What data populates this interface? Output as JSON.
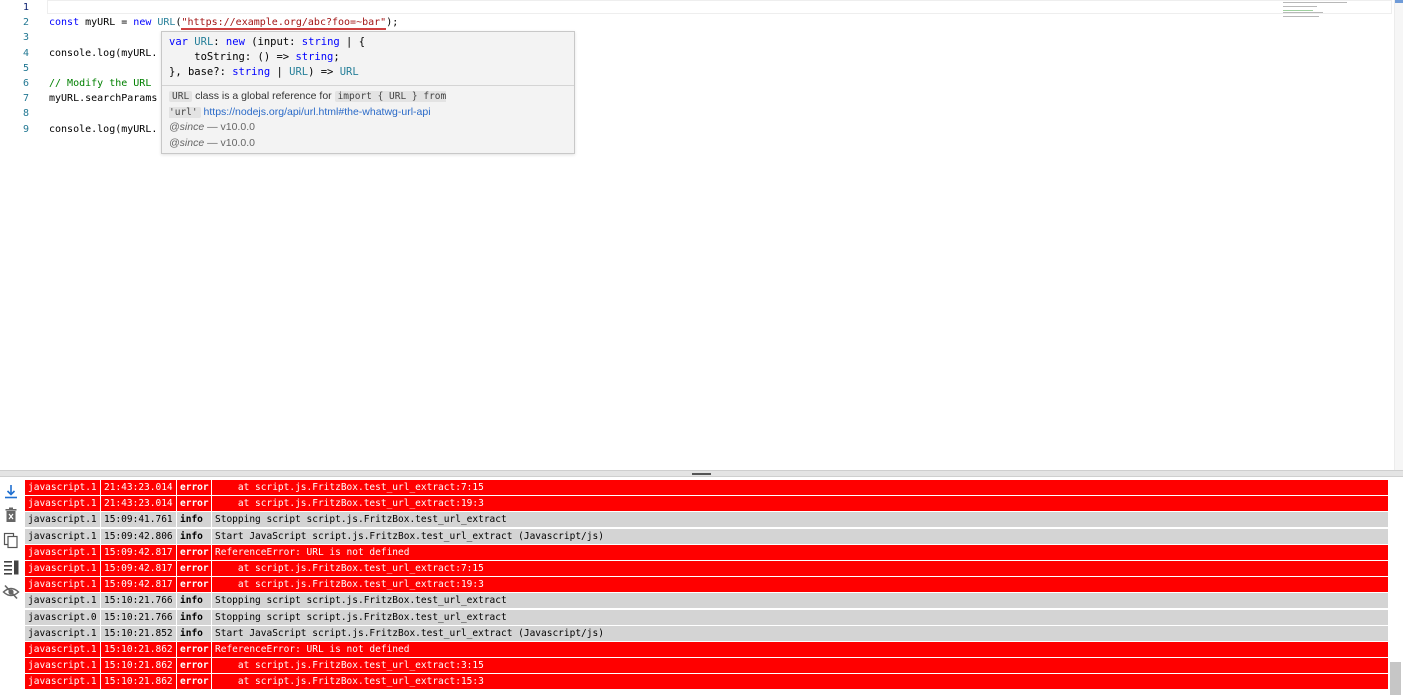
{
  "editor": {
    "line_numbers": [
      "1",
      "2",
      "3",
      "4",
      "5",
      "6",
      "7",
      "8",
      "9"
    ],
    "line2": {
      "kw_const": "const",
      "var_decl": " myURL = ",
      "kw_new": "new",
      "sp": " ",
      "type_url": "URL",
      "open": "(",
      "string": "\"https://example.org/abc?foo=~bar\"",
      "close": ");"
    },
    "line4": "console.log(myURL.",
    "line6_comment": "// Modify the URL ",
    "line7": "myURL.searchParams",
    "line9": "console.log(myURL."
  },
  "hover": {
    "sig_l1_kw": "var",
    "sig_l1_a": " ",
    "sig_l1_type": "URL",
    "sig_l1_b": ": ",
    "sig_l1_new": "new",
    "sig_l1_c": " (input: ",
    "sig_l1_string": "string",
    "sig_l1_d": " | {",
    "sig_l2_a": "    toString: () => ",
    "sig_l2_string": "string",
    "sig_l2_b": ";",
    "sig_l3_a": "}, base?: ",
    "sig_l3_string": "string",
    "sig_l3_b": " | ",
    "sig_l3_type": "URL",
    "sig_l3_c": ") => ",
    "sig_l3_ret": "URL",
    "doc_code1": "URL",
    "doc_text1": " class is a global reference for ",
    "doc_code2": "import { URL } from 'url'",
    "doc_link": "https://nodejs.org/api/url.html#the-whatwg-url-api",
    "since1_tag": "@since",
    "since1_val": " — v10.0.0",
    "since2_tag": "@since",
    "since2_val": " — v10.0.0"
  },
  "toolbar": {
    "icons": [
      "scroll-to-bottom-icon",
      "clear-log-icon",
      "copy-icon",
      "wrap-lines-icon",
      "hide-icon"
    ]
  },
  "log": {
    "rows": [
      {
        "source": "javascript.1",
        "time": "21:43:23.014",
        "level": "error",
        "message": "    at script.js.FritzBox.test_url_extract:7:15"
      },
      {
        "source": "javascript.1",
        "time": "21:43:23.014",
        "level": "error",
        "message": "    at script.js.FritzBox.test_url_extract:19:3"
      },
      {
        "source": "javascript.1",
        "time": "15:09:41.761",
        "level": "info",
        "message": "Stopping script script.js.FritzBox.test_url_extract"
      },
      {
        "source": "javascript.1",
        "time": "15:09:42.806",
        "level": "info",
        "message": "Start JavaScript script.js.FritzBox.test_url_extract (Javascript/js)"
      },
      {
        "source": "javascript.1",
        "time": "15:09:42.817",
        "level": "error",
        "message": "ReferenceError: URL is not defined"
      },
      {
        "source": "javascript.1",
        "time": "15:09:42.817",
        "level": "error",
        "message": "    at script.js.FritzBox.test_url_extract:7:15"
      },
      {
        "source": "javascript.1",
        "time": "15:09:42.817",
        "level": "error",
        "message": "    at script.js.FritzBox.test_url_extract:19:3"
      },
      {
        "source": "javascript.1",
        "time": "15:10:21.766",
        "level": "info",
        "message": "Stopping script script.js.FritzBox.test_url_extract"
      },
      {
        "source": "javascript.0",
        "time": "15:10:21.766",
        "level": "info",
        "message": "Stopping script script.js.FritzBox.test_url_extract"
      },
      {
        "source": "javascript.1",
        "time": "15:10:21.852",
        "level": "info",
        "message": "Start JavaScript script.js.FritzBox.test_url_extract (Javascript/js)"
      },
      {
        "source": "javascript.1",
        "time": "15:10:21.862",
        "level": "error",
        "message": "ReferenceError: URL is not defined"
      },
      {
        "source": "javascript.1",
        "time": "15:10:21.862",
        "level": "error",
        "message": "    at script.js.FritzBox.test_url_extract:3:15"
      },
      {
        "source": "javascript.1",
        "time": "15:10:21.862",
        "level": "error",
        "message": "    at script.js.FritzBox.test_url_extract:15:3"
      }
    ]
  },
  "colors": {
    "error_row": "#ff0000",
    "info_row": "#d4d4d4",
    "keyword": "#0000ff",
    "type": "#267f99",
    "string": "#a31515",
    "comment": "#008000"
  }
}
